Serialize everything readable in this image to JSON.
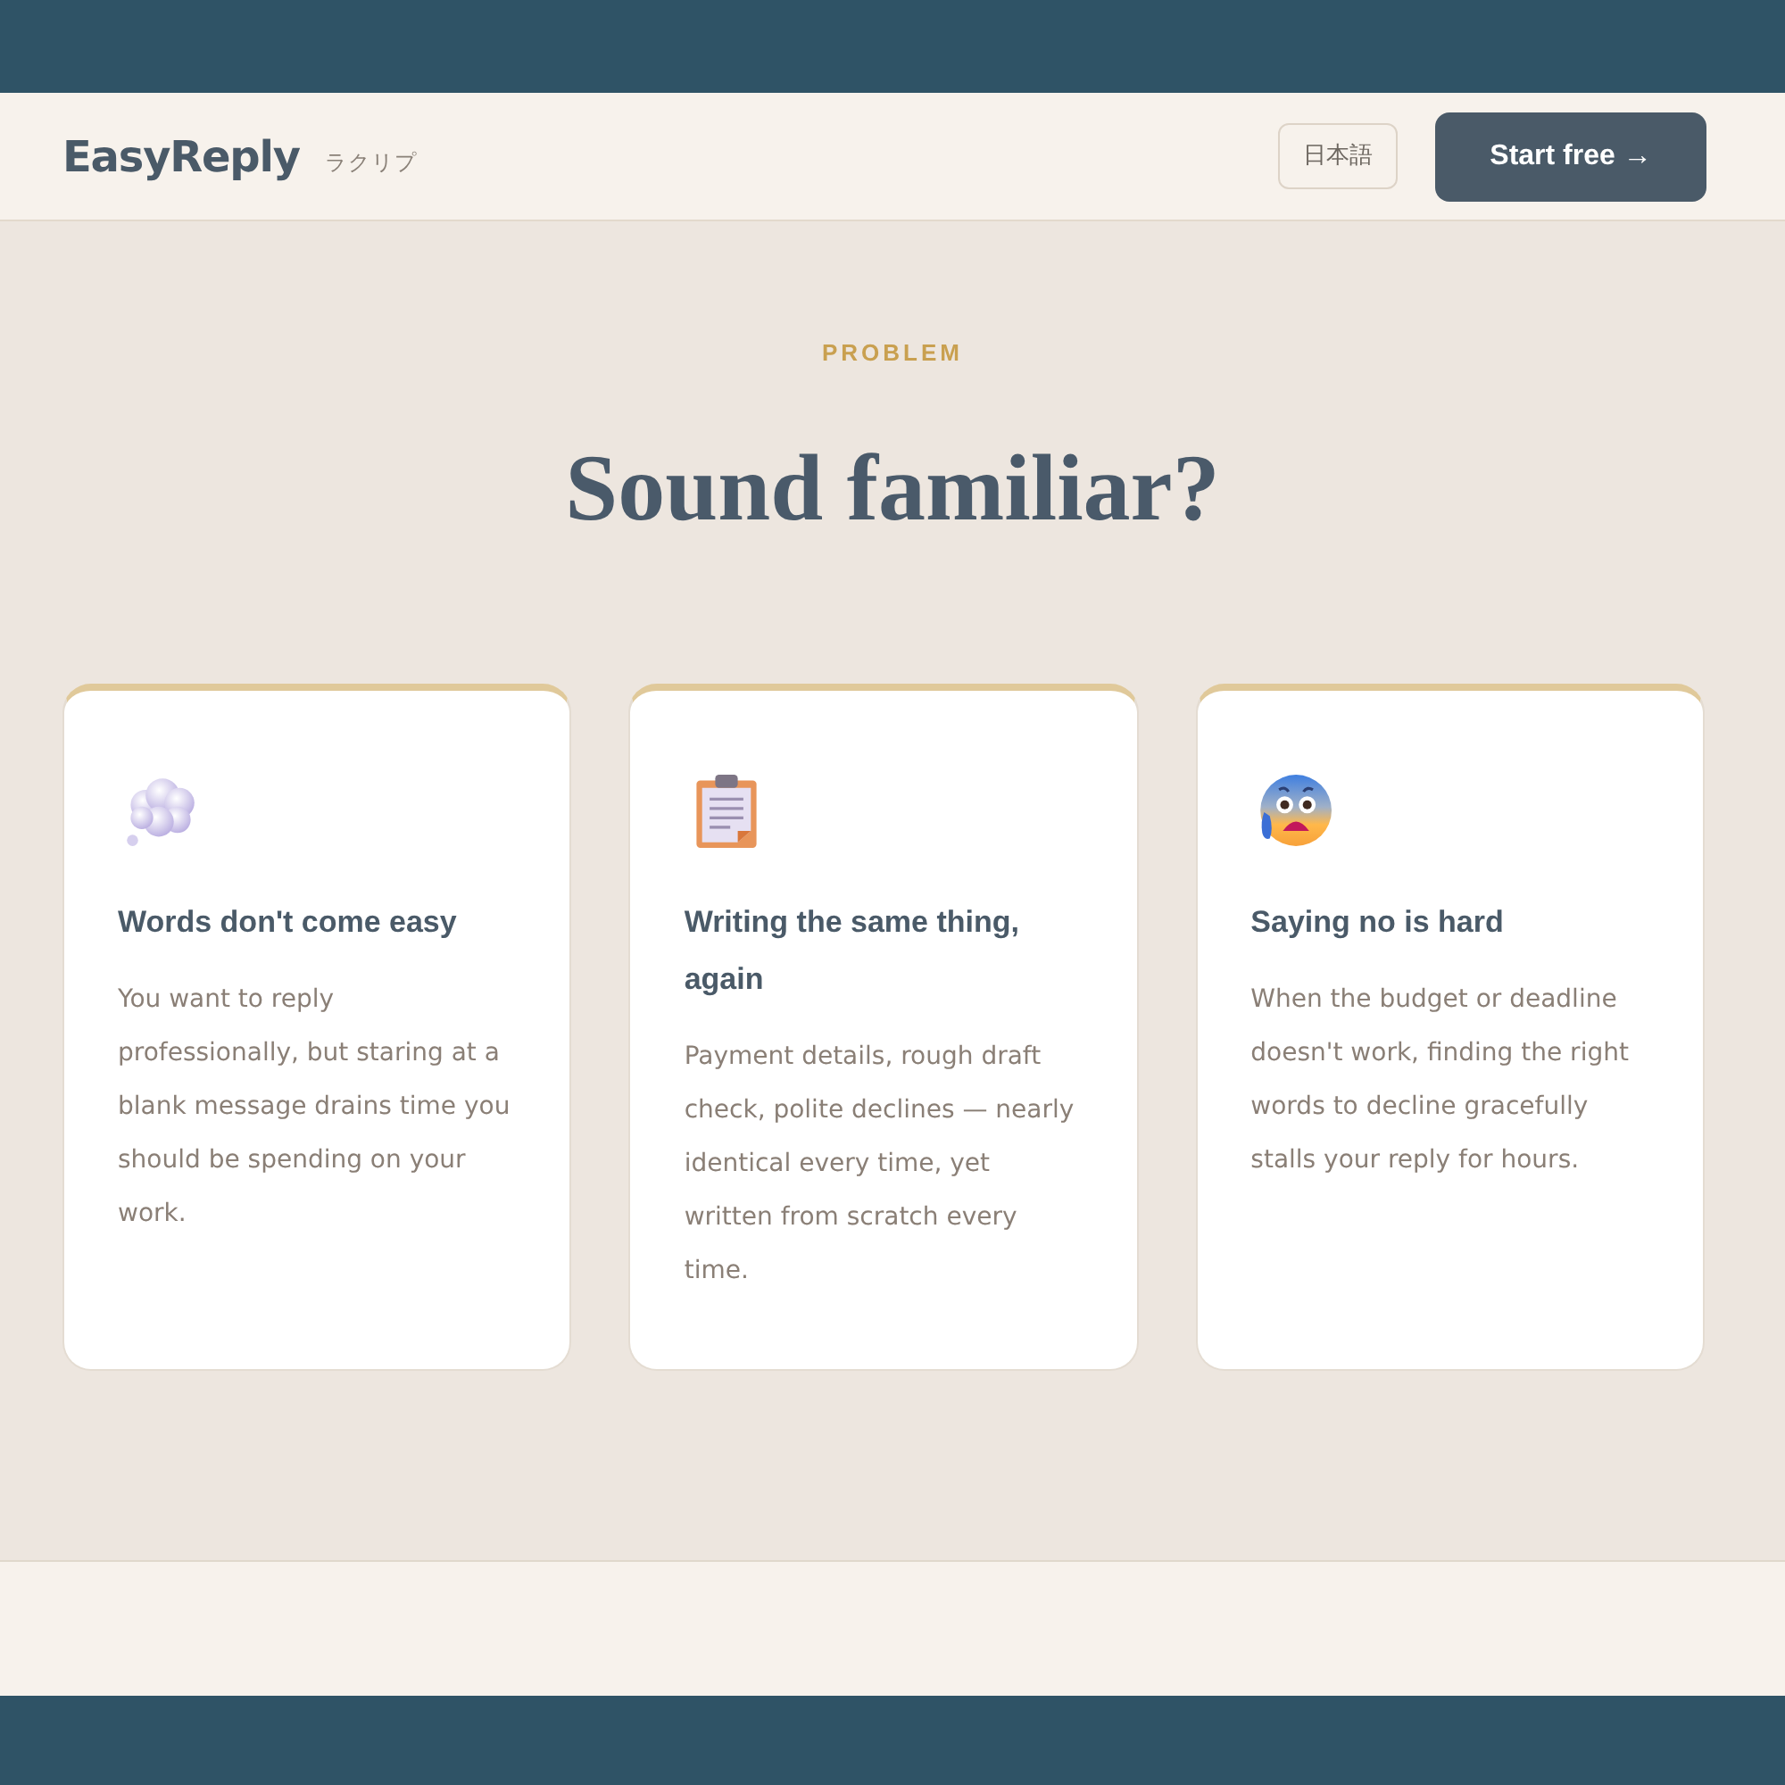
{
  "header": {
    "logo": "EasyReply",
    "logo_subtitle": "ラクリプ",
    "language_button": "日本語",
    "cta_button": "Start free →"
  },
  "section": {
    "eyebrow": "PROBLEM",
    "heading": "Sound familiar?",
    "cards": [
      {
        "kind": "thought",
        "title": "Words don't come easy",
        "body": "You want to reply professionally, but staring at a blank message drains time you should be spending on your work."
      },
      {
        "kind": "clipboard",
        "title": "Writing the same thing, again",
        "body": "Payment details, rough draft check, polite declines — nearly identical every time, yet written from scratch every time."
      },
      {
        "kind": "anxious",
        "title": "Saying no is hard",
        "body": "When the budget or deadline doesn't work, finding the right words to decline gracefully stalls your reply for hours."
      }
    ]
  }
}
